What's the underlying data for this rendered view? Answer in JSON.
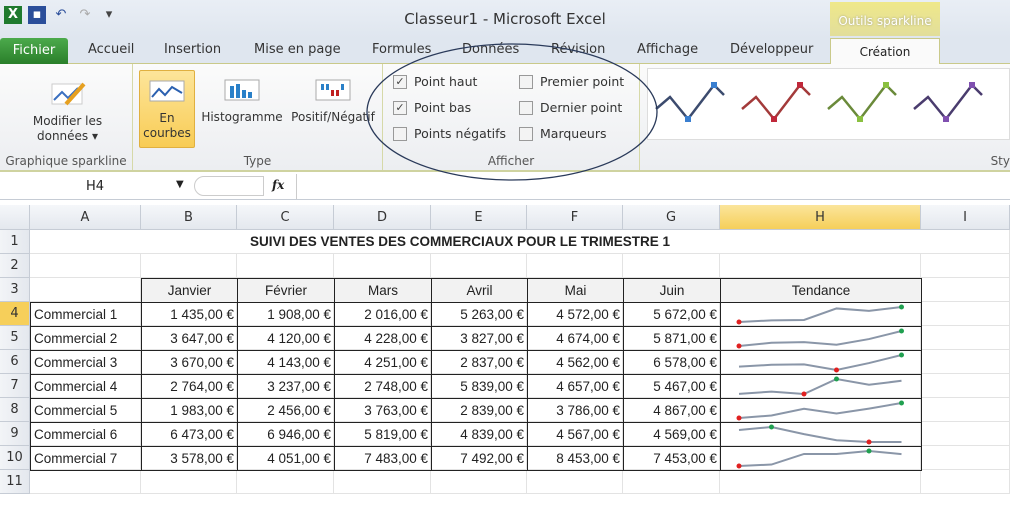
{
  "window": {
    "title": "Classeur1  -  Microsoft Excel",
    "context_tab_header": "Outils sparkline"
  },
  "qat": {
    "icons": [
      "excel-logo-icon",
      "save-icon",
      "undo-icon",
      "redo-icon",
      "customize-qat-icon"
    ]
  },
  "tabs": [
    "Fichier",
    "Accueil",
    "Insertion",
    "Mise en page",
    "Formules",
    "Données",
    "Révision",
    "Affichage",
    "Développeur",
    "Création"
  ],
  "active_tab": "Création",
  "ribbon": {
    "groups": {
      "sparkline": "Graphique sparkline",
      "type": "Type",
      "show": "Afficher",
      "style": "Sty"
    },
    "edit_data": {
      "line1": "Modifier les",
      "line2": "données ▾"
    },
    "type_buttons": {
      "line_1": "En",
      "line_2": "courbes",
      "column": "Histogramme",
      "winloss": "Positif/Négatif"
    },
    "checkboxes": [
      {
        "label": "Point haut",
        "checked": true
      },
      {
        "label": "Point bas",
        "checked": true
      },
      {
        "label": "Points négatifs",
        "checked": false
      },
      {
        "label": "Premier point",
        "checked": false
      },
      {
        "label": "Dernier point",
        "checked": false
      },
      {
        "label": "Marqueurs",
        "checked": false
      }
    ],
    "style_colors": [
      "#3c4b6e",
      "#a33a3a",
      "#6a8a3a",
      "#4a3c6e"
    ],
    "style_marker_colors": [
      "#3a7fd0",
      "#c0283a",
      "#8ac040",
      "#8050b0"
    ]
  },
  "formula_bar": {
    "name_box": "H4",
    "fx": "fx",
    "value": ""
  },
  "sheet": {
    "columns": [
      "A",
      "B",
      "C",
      "D",
      "E",
      "F",
      "G",
      "H",
      "I"
    ],
    "rows": [
      "1",
      "2",
      "3",
      "4",
      "5",
      "6",
      "7",
      "8",
      "9",
      "10",
      "11"
    ],
    "selected_column": "H",
    "selected_row": "4",
    "title": "SUIVI DES VENTES DES COMMERCIAUX POUR LE TRIMESTRE 1",
    "headers": [
      "Janvier",
      "Février",
      "Mars",
      "Avril",
      "Mai",
      "Juin",
      "Tendance"
    ],
    "data": [
      {
        "name": "Commercial 1",
        "values": [
          "1 435,00 €",
          "1 908,00 €",
          "2 016,00 €",
          "5 263,00 €",
          "4 572,00 €",
          "5 672,00 €"
        ]
      },
      {
        "name": "Commercial 2",
        "values": [
          "3 647,00 €",
          "4 120,00 €",
          "4 228,00 €",
          "3 827,00 €",
          "4 674,00 €",
          "5 871,00 €"
        ]
      },
      {
        "name": "Commercial 3",
        "values": [
          "3 670,00 €",
          "4 143,00 €",
          "4 251,00 €",
          "2 837,00 €",
          "4 562,00 €",
          "6 578,00 €"
        ]
      },
      {
        "name": "Commercial 4",
        "values": [
          "2 764,00 €",
          "3 237,00 €",
          "2 748,00 €",
          "5 839,00 €",
          "4 657,00 €",
          "5 467,00 €"
        ]
      },
      {
        "name": "Commercial 5",
        "values": [
          "1 983,00 €",
          "2 456,00 €",
          "3 763,00 €",
          "2 839,00 €",
          "3 786,00 €",
          "4 867,00 €"
        ]
      },
      {
        "name": "Commercial 6",
        "values": [
          "6 473,00 €",
          "6 946,00 €",
          "5 819,00 €",
          "4 839,00 €",
          "4 567,00 €",
          "4 569,00 €"
        ]
      },
      {
        "name": "Commercial 7",
        "values": [
          "3 578,00 €",
          "4 051,00 €",
          "7 483,00 €",
          "7 492,00 €",
          "8 453,00 €",
          "7 453,00 €"
        ]
      }
    ],
    "sparkline": {
      "line_color": "#8a96a8",
      "high_color": "#20a050",
      "low_color": "#e02020"
    }
  }
}
